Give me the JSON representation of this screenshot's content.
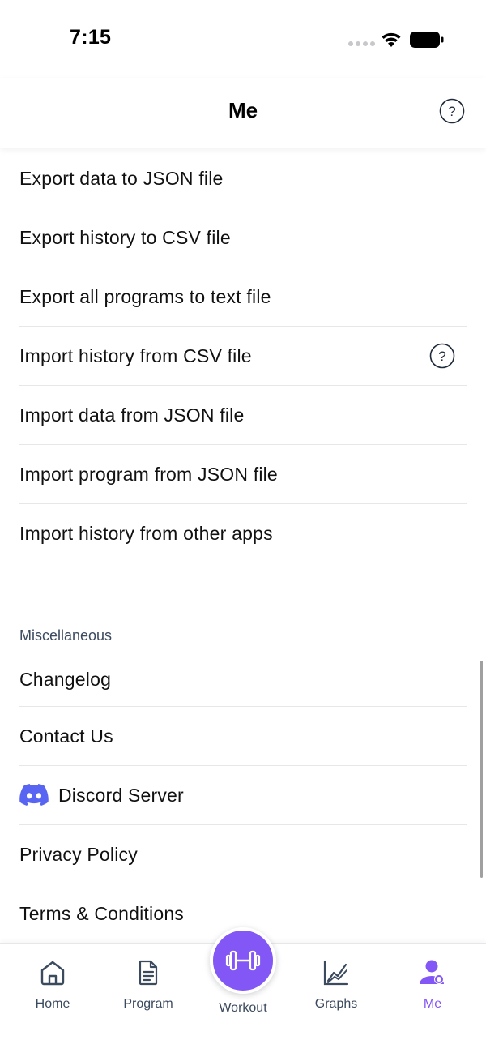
{
  "status_bar": {
    "time": "7:15"
  },
  "header": {
    "title": "Me"
  },
  "data_section": {
    "items": [
      {
        "label": "Export data to JSON file"
      },
      {
        "label": "Export history to CSV file"
      },
      {
        "label": "Export all programs to text file"
      },
      {
        "label": "Import history from CSV file"
      },
      {
        "label": "Import data from JSON file"
      },
      {
        "label": "Import program from JSON file"
      },
      {
        "label": "Import history from other apps"
      }
    ]
  },
  "misc_section": {
    "title": "Miscellaneous",
    "items": [
      {
        "label": "Changelog"
      },
      {
        "label": "Contact Us"
      },
      {
        "label": "Discord Server"
      },
      {
        "label": "Privacy Policy"
      },
      {
        "label": "Terms & Conditions"
      }
    ]
  },
  "tabbar": {
    "tabs": [
      {
        "label": "Home",
        "icon": "home-icon"
      },
      {
        "label": "Program",
        "icon": "document-icon"
      },
      {
        "label": "Workout",
        "icon": "dumbbell-icon"
      },
      {
        "label": "Graphs",
        "icon": "chart-icon"
      },
      {
        "label": "Me",
        "icon": "user-icon"
      }
    ],
    "active": "Me"
  },
  "colors": {
    "accent": "#8356f6",
    "discord": "#5865f2",
    "muted_text": "#3b4a5e"
  }
}
